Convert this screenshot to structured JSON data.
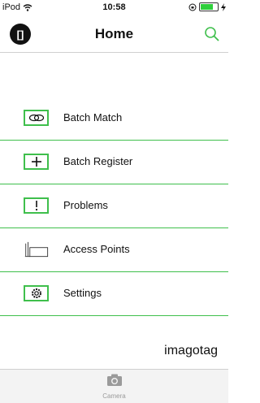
{
  "status": {
    "carrier": "iPod",
    "time": "10:58"
  },
  "nav": {
    "logo_text": "[]",
    "title": "Home"
  },
  "menu": [
    {
      "label": "Batch Match",
      "icon": "link-icon"
    },
    {
      "label": "Batch Register",
      "icon": "plus-icon"
    },
    {
      "label": "Problems",
      "icon": "exclamation-icon"
    },
    {
      "label": "Access Points",
      "icon": "access-point-icon"
    },
    {
      "label": "Settings",
      "icon": "settings-icon"
    }
  ],
  "brand": "imagotag",
  "tabbar": {
    "camera_label": "Camera"
  },
  "colors": {
    "accent": "#3fbf4c",
    "battery": "#2fcf3c"
  }
}
